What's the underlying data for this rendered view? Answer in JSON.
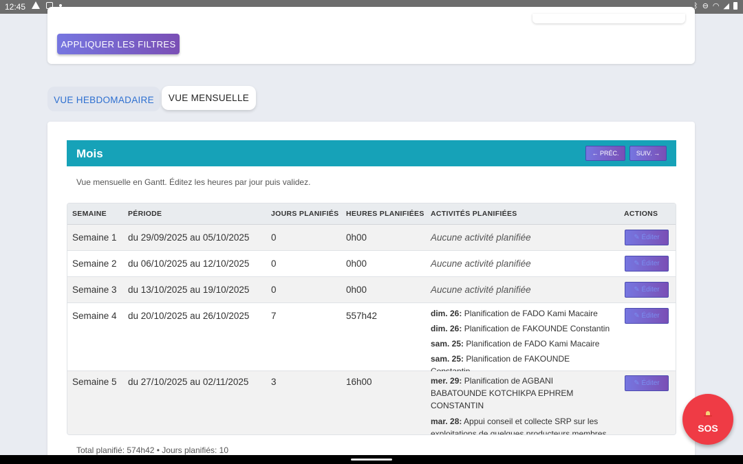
{
  "status": {
    "time": "12:45"
  },
  "filters": {
    "apply_label": "APPLIQUER LES FILTRES"
  },
  "tabs": {
    "weekly": "VUE HEBDOMADAIRE",
    "monthly": "VUE MENSUELLE"
  },
  "month": {
    "title": "Mois",
    "prev_label": "← PRÉC.",
    "next_label": "SUIV. →",
    "subtitle": "Vue mensuelle en Gantt. Éditez les heures par jour puis validez."
  },
  "table": {
    "headers": [
      "SEMAINE",
      "PÉRIODE",
      "JOURS PLANIFIÉS",
      "HEURES PLANIFIÉES",
      "ACTIVITÉS PLANIFIÉES",
      "ACTIONS"
    ],
    "edit_label": "✎ Éditer",
    "rows": [
      {
        "week": "Semaine 1",
        "period": "du 29/09/2025 au 05/10/2025",
        "days": "0",
        "hours": "0h00",
        "empty": "Aucune activité planifiée",
        "activities": []
      },
      {
        "week": "Semaine 2",
        "period": "du 06/10/2025 au 12/10/2025",
        "days": "0",
        "hours": "0h00",
        "empty": "Aucune activité planifiée",
        "activities": []
      },
      {
        "week": "Semaine 3",
        "period": "du 13/10/2025 au 19/10/2025",
        "days": "0",
        "hours": "0h00",
        "empty": "Aucune activité planifiée",
        "activities": []
      },
      {
        "week": "Semaine 4",
        "period": "du 20/10/2025 au 26/10/2025",
        "days": "7",
        "hours": "557h42",
        "empty": "",
        "activities": [
          {
            "day": "dim. 26:",
            "text": "Planification de FADO Kami Macaire"
          },
          {
            "day": "dim. 26:",
            "text": "Planification de FAKOUNDE Constantin"
          },
          {
            "day": "sam. 25:",
            "text": "Planification de FADO Kami Macaire"
          },
          {
            "day": "sam. 25:",
            "text": "Planification de FAKOUNDE Constantin"
          }
        ]
      },
      {
        "week": "Semaine 5",
        "period": "du 27/10/2025 au 02/11/2025",
        "days": "3",
        "hours": "16h00",
        "empty": "",
        "activities": [
          {
            "day": "mer. 29:",
            "text": "Planification de AGBANI BABATOUNDE KOTCHIKPA EPHREM CONSTANTIN"
          },
          {
            "day": "mar. 28:",
            "text": "Appui conseil et collecte SRP sur les exploitations de quelques producteurs membres UCA d'Ouake"
          }
        ]
      }
    ]
  },
  "total": "Total planifié: 574h42 • Jours planifiés: 10",
  "sos": {
    "label": "SOS"
  }
}
